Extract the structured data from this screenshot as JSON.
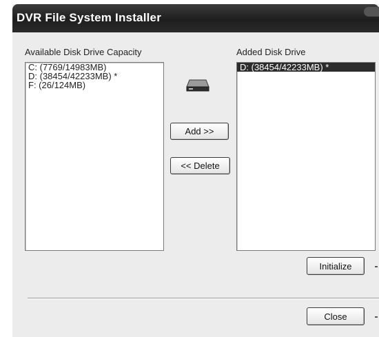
{
  "window": {
    "title": "DVR File System Installer"
  },
  "available": {
    "label": "Available Disk Drive Capacity",
    "items": [
      "C:  (7769/14983MB)",
      "D:  (38454/42233MB) *",
      "F:  (26/124MB)"
    ]
  },
  "added": {
    "label": "Added Disk Drive",
    "items": [
      "D:  (38454/42233MB) *"
    ],
    "selected_index": 0
  },
  "buttons": {
    "add": "Add >>",
    "delete": "<< Delete",
    "initialize": "Initialize",
    "close": "Close"
  },
  "icons": {
    "drive": "hard-drive-icon"
  }
}
